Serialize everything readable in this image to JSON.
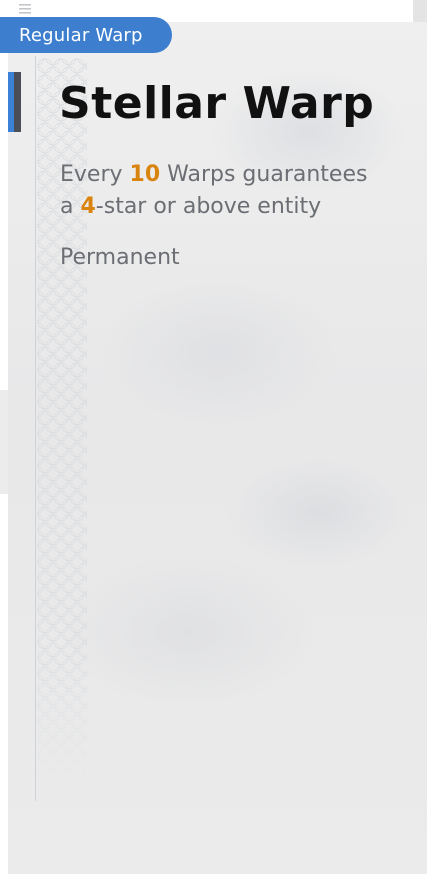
{
  "tab": {
    "label": "Regular Warp"
  },
  "banner": {
    "title": "Stellar Warp",
    "description": {
      "line1_prefix": "Every ",
      "line1_number": "10",
      "line1_suffix": " Warps guarantees",
      "line2_prefix": "a ",
      "line2_number": "4",
      "line2_suffix": "-star or above entity"
    },
    "duration": "Permanent"
  },
  "colors": {
    "tab_background": "#3d7fce",
    "highlight": "#d9840f",
    "title_text": "#111111",
    "body_text": "#6b6e73",
    "accent_blue": "#3b82d6"
  },
  "icons": [
    "menu-icon"
  ]
}
